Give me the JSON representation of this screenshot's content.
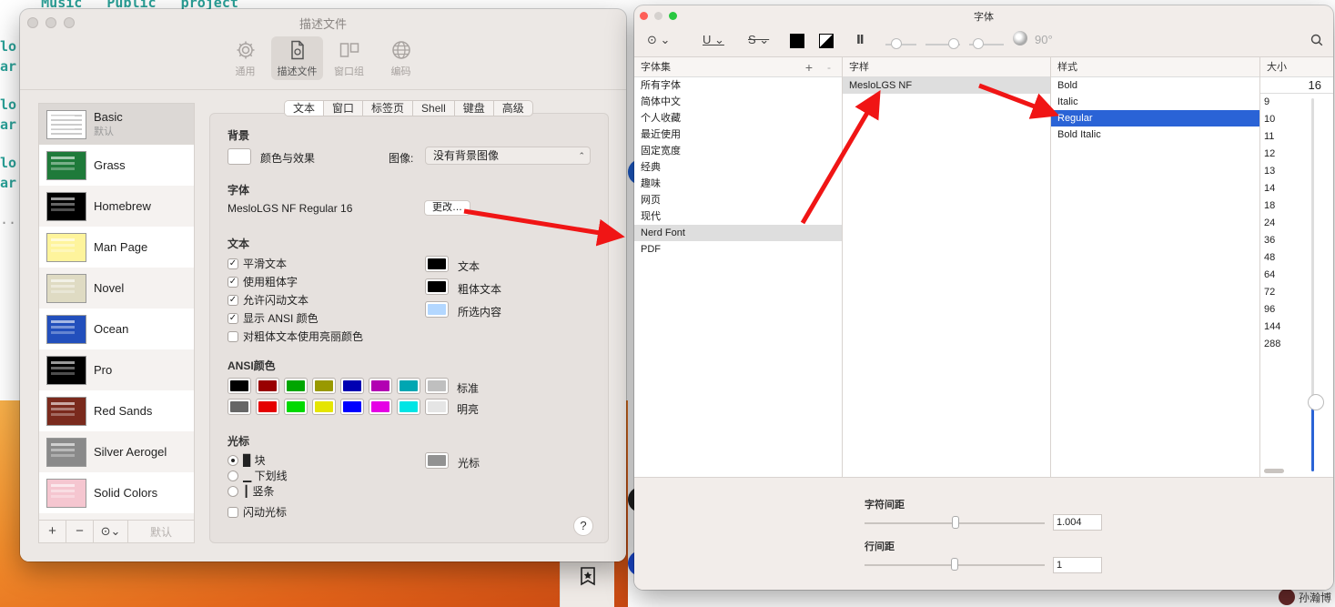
{
  "terminal": {
    "top_line": "ary  Music   Public   project",
    "lines": [
      "lo",
      "ar",
      "lo",
      "ar",
      "lo",
      "ar",
      ".."
    ]
  },
  "profiles_window": {
    "title": "描述文件",
    "toolbar": [
      {
        "label": "通用",
        "icon": "gear-icon"
      },
      {
        "label": "描述文件",
        "icon": "document-icon",
        "active": true
      },
      {
        "label": "窗口组",
        "icon": "window-group-icon"
      },
      {
        "label": "编码",
        "icon": "globe-icon"
      }
    ],
    "profiles": [
      {
        "name": "Basic",
        "sub": "默认",
        "thumb": "#ffffff"
      },
      {
        "name": "Grass",
        "thumb": "#1f7a3a"
      },
      {
        "name": "Homebrew",
        "thumb": "#000000"
      },
      {
        "name": "Man Page",
        "thumb": "#fef49c"
      },
      {
        "name": "Novel",
        "thumb": "#dfdbc3"
      },
      {
        "name": "Ocean",
        "thumb": "#224fbc"
      },
      {
        "name": "Pro",
        "thumb": "#000000"
      },
      {
        "name": "Red Sands",
        "thumb": "#7a2a1d"
      },
      {
        "name": "Silver Aerogel",
        "thumb": "#8a8a8a"
      },
      {
        "name": "Solid Colors",
        "thumb": "#f5c6d0"
      }
    ],
    "footer": {
      "add": "+",
      "remove": "−",
      "more": "⊙⌄",
      "default": "默认"
    },
    "tabs": [
      "文本",
      "窗口",
      "标签页",
      "Shell",
      "键盘",
      "高级"
    ],
    "background": {
      "section": "背景",
      "color_effects": "颜色与效果",
      "image_label": "图像:",
      "image_value": "没有背景图像"
    },
    "font": {
      "section": "字体",
      "value": "MesloLGS NF Regular 16",
      "change_button": "更改…"
    },
    "text": {
      "section": "文本",
      "options": [
        {
          "label": "平滑文本",
          "checked": true
        },
        {
          "label": "使用粗体字",
          "checked": true
        },
        {
          "label": "允许闪动文本",
          "checked": true
        },
        {
          "label": "显示 ANSI 颜色",
          "checked": true
        },
        {
          "label": "对粗体文本使用亮丽颜色",
          "checked": false
        }
      ],
      "colors": [
        {
          "label": "文本",
          "color": "#000000"
        },
        {
          "label": "粗体文本",
          "color": "#000000"
        },
        {
          "label": "所选内容",
          "color": "#b3d7ff"
        }
      ]
    },
    "ansi": {
      "section": "ANSI颜色",
      "normal_label": "标准",
      "bright_label": "明亮",
      "normal": [
        "#000000",
        "#990000",
        "#00a600",
        "#999900",
        "#0000b2",
        "#b200b2",
        "#00a6b2",
        "#bfbfbf"
      ],
      "bright": [
        "#666666",
        "#e50000",
        "#00d900",
        "#e5e500",
        "#0000ff",
        "#e500e5",
        "#00e5e5",
        "#e5e5e5"
      ]
    },
    "cursor": {
      "section": "光标",
      "options": [
        {
          "label": "▉ 块",
          "selected": true
        },
        {
          "label": "▁ 下划线",
          "selected": false
        },
        {
          "label": "┃ 竖条",
          "selected": false
        }
      ],
      "blink": "闪动光标",
      "color_label": "光标",
      "color": "#929292"
    },
    "help": "?"
  },
  "fonts_window": {
    "title": "字体",
    "toolbar": {
      "action": "⊙ ⌄",
      "underline": "U ⌄",
      "strike": "S ⌄",
      "paragraph": "Ⅱ",
      "rotation": "90°"
    },
    "columns": {
      "collections_header": "字体集",
      "family_header": "字样",
      "style_header": "样式",
      "size_header": "大小"
    },
    "collections": [
      "所有字体",
      "简体中文",
      "个人收藏",
      "最近使用",
      "固定宽度",
      "经典",
      "趣味",
      "网页",
      "现代",
      "Nerd Font",
      "PDF"
    ],
    "selected_collection": "Nerd Font",
    "families": [
      "MesloLGS NF"
    ],
    "styles": [
      "Bold",
      "Italic",
      "Regular",
      "Bold Italic"
    ],
    "selected_style": "Regular",
    "size_value": "16",
    "sizes": [
      "9",
      "10",
      "11",
      "12",
      "13",
      "14",
      "18",
      "24",
      "36",
      "48",
      "64",
      "72",
      "96",
      "144",
      "288"
    ],
    "char_spacing_label": "字符间距",
    "char_spacing_value": "1.004",
    "line_spacing_label": "行间距",
    "line_spacing_value": "1"
  },
  "user": {
    "name": "孙瀚博"
  }
}
